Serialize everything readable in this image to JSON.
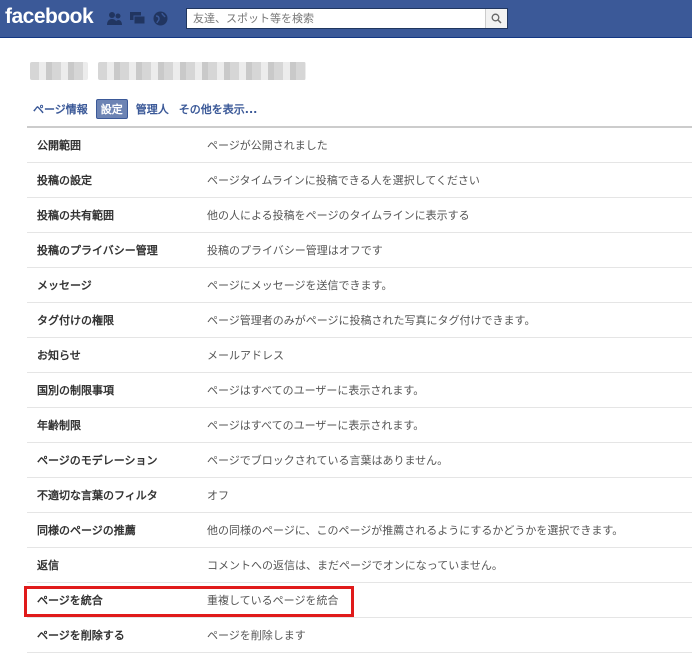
{
  "topbar": {
    "logo": "facebook",
    "search_placeholder": "友達、スポット等を検索",
    "icons": [
      "friend-requests-icon",
      "messages-icon",
      "notifications-globe-icon",
      "search-icon"
    ]
  },
  "tabs": [
    {
      "label": "ページ情報",
      "active": false
    },
    {
      "label": "設定",
      "active": true
    },
    {
      "label": "管理人",
      "active": false
    },
    {
      "label": "その他を表示...",
      "active": false
    }
  ],
  "settings": [
    {
      "label": "公開範囲",
      "value": "ページが公開されました"
    },
    {
      "label": "投稿の設定",
      "value": "ページタイムラインに投稿できる人を選択してください"
    },
    {
      "label": "投稿の共有範囲",
      "value": "他の人による投稿をページのタイムラインに表示する"
    },
    {
      "label": "投稿のプライバシー管理",
      "value": "投稿のプライバシー管理はオフです"
    },
    {
      "label": "メッセージ",
      "value": "ページにメッセージを送信できます。"
    },
    {
      "label": "タグ付けの権限",
      "value": "ページ管理者のみがページに投稿された写真にタグ付けできます。"
    },
    {
      "label": "お知らせ",
      "value": "メールアドレス"
    },
    {
      "label": "国別の制限事項",
      "value": "ページはすべてのユーザーに表示されます。"
    },
    {
      "label": "年齢制限",
      "value": "ページはすべてのユーザーに表示されます。"
    },
    {
      "label": "ページのモデレーション",
      "value": "ページでブロックされている言葉はありません。"
    },
    {
      "label": "不適切な言葉のフィルタ",
      "value": "オフ"
    },
    {
      "label": "同様のページの推薦",
      "value": "他の同様のページに、このページが推薦されるようにするかどうかを選択できます。"
    },
    {
      "label": "返信",
      "value": "コメントへの返信は、まだページでオンになっていません。"
    },
    {
      "label": "ページを統合",
      "value": "重複しているページを統合"
    },
    {
      "label": "ページを削除する",
      "value": "ページを削除します"
    }
  ],
  "colors": {
    "brand": "#3b5998",
    "highlight": "#e01a1a"
  }
}
